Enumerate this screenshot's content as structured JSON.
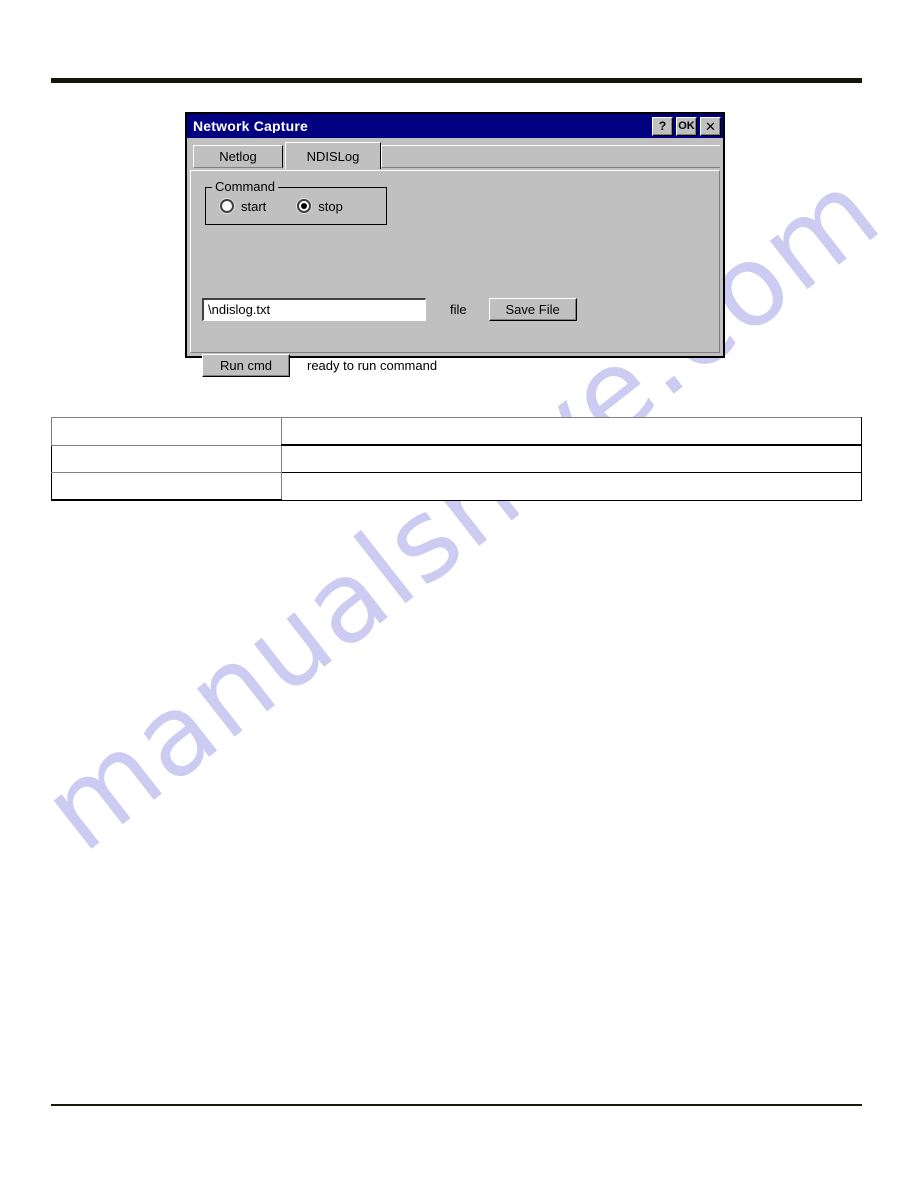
{
  "page": {
    "rule_top": "horizontal-rule",
    "rule_bottom": "horizontal-rule",
    "watermark_text": "manualshive.com",
    "watermark_color": "#ccccf2"
  },
  "dialog": {
    "title": "Network Capture",
    "titlebar_color": "#000080",
    "face_color": "#c0c0c0",
    "titlebar_buttons": {
      "help_label": "?",
      "ok_label": "OK",
      "close_label": "✕"
    },
    "tabs": [
      {
        "label": "Netlog",
        "active": false
      },
      {
        "label": "NDISLog",
        "active": true
      }
    ],
    "command_group": {
      "legend": "Command",
      "options": [
        {
          "label": "start",
          "selected": false
        },
        {
          "label": "stop",
          "selected": true
        }
      ]
    },
    "file_row": {
      "input_value": "\\ndislog.txt",
      "input_placeholder": "",
      "label": "file",
      "save_button_label": "Save File"
    },
    "run_row": {
      "run_button_label": "Run cmd",
      "status_text": "ready to run command"
    }
  },
  "doc_table": {
    "rows": [
      {
        "col_a": "",
        "col_b": ""
      },
      {
        "col_a": "",
        "col_b": ""
      },
      {
        "col_a": "",
        "col_b": ""
      }
    ]
  }
}
